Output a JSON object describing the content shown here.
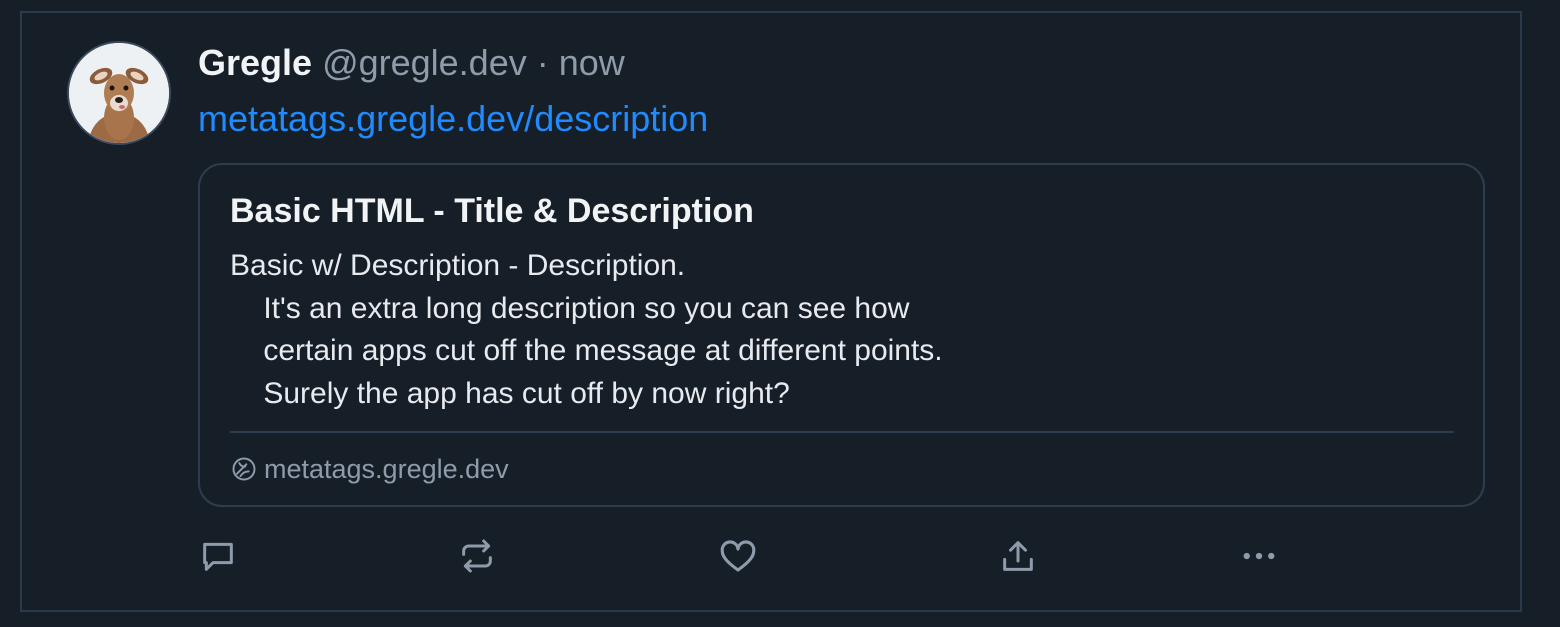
{
  "post": {
    "author": {
      "display_name": "Gregle",
      "handle": "@gregle.dev",
      "separator": "·",
      "timestamp": "now",
      "avatar_icon": "deer-avatar"
    },
    "text_link": "metatags.gregle.dev/description",
    "link_card": {
      "title": "Basic HTML - Title & Description",
      "description": "Basic w/ Description - Description.\n    It's an extra long description so you can see how\n    certain apps cut off the message at different points.\n    Surely the app has cut off by now right?",
      "domain": "metatags.gregle.dev",
      "domain_icon": "globe-icon"
    },
    "actions": [
      {
        "icon": "reply-icon"
      },
      {
        "icon": "repost-icon"
      },
      {
        "icon": "like-icon"
      },
      {
        "icon": "share-icon"
      },
      {
        "icon": "more-icon"
      }
    ]
  },
  "colors": {
    "background": "#161e27",
    "link": "#208bfe",
    "muted": "#8e9bab",
    "border": "#2e3d4e"
  }
}
